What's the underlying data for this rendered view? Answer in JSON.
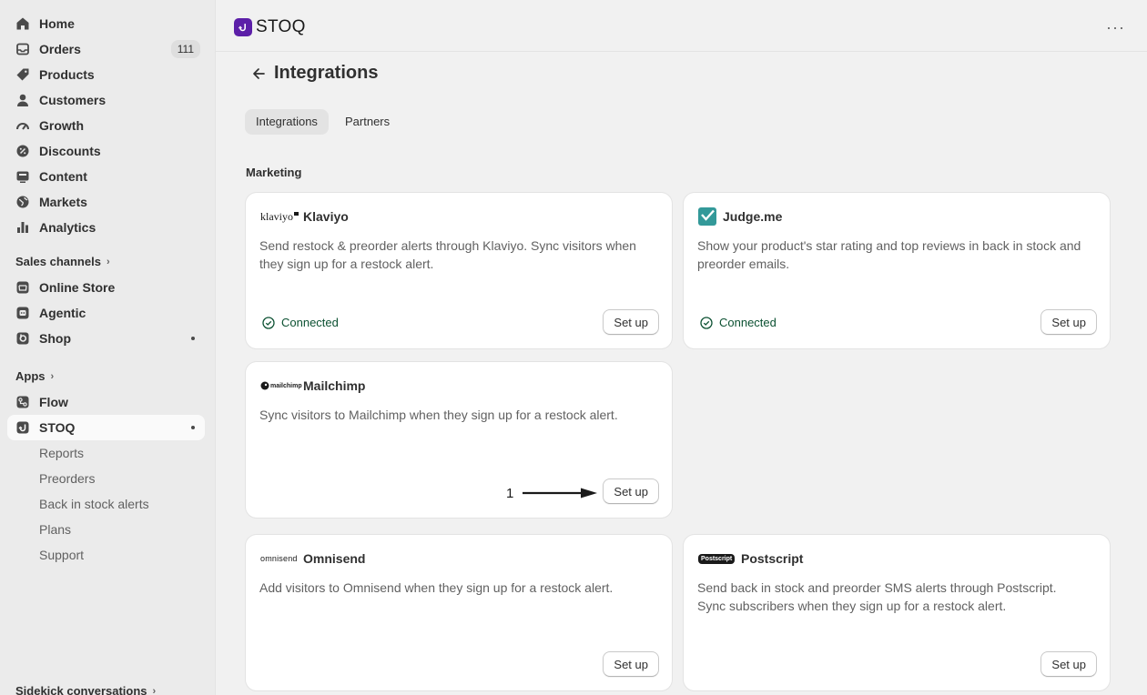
{
  "sidebar": {
    "nav": [
      {
        "label": "Home",
        "icon": "home-icon"
      },
      {
        "label": "Orders",
        "icon": "orders-icon",
        "badge": "111"
      },
      {
        "label": "Products",
        "icon": "tag-icon"
      },
      {
        "label": "Customers",
        "icon": "person-icon"
      },
      {
        "label": "Growth",
        "icon": "gauge-icon"
      },
      {
        "label": "Discounts",
        "icon": "discount-icon"
      },
      {
        "label": "Content",
        "icon": "content-icon"
      },
      {
        "label": "Markets",
        "icon": "globe-icon"
      },
      {
        "label": "Analytics",
        "icon": "bar-chart-icon"
      }
    ],
    "sales_channels": {
      "heading": "Sales channels",
      "items": [
        {
          "label": "Online Store",
          "icon": "store-icon"
        },
        {
          "label": "Agentic",
          "icon": "agent-icon"
        },
        {
          "label": "Shop",
          "icon": "shop-icon"
        }
      ]
    },
    "apps": {
      "heading": "Apps",
      "items": [
        {
          "label": "Flow",
          "icon": "flow-icon"
        },
        {
          "label": "STOQ",
          "icon": "stoq-app-icon"
        }
      ],
      "sub_items": [
        "Reports",
        "Preorders",
        "Back in stock alerts",
        "Plans",
        "Support"
      ]
    },
    "footer": "Sidekick conversations"
  },
  "topbar": {
    "app_name": "STOQ",
    "more": "···"
  },
  "page": {
    "title": "Integrations",
    "tabs": [
      "Integrations",
      "Partners"
    ],
    "section": "Marketing"
  },
  "cards": [
    {
      "name": "Klaviyo",
      "logo_text": "klaviyo",
      "desc": "Send restock & preorder alerts through Klaviyo. Sync visitors when they sign up for a restock alert.",
      "status": "Connected",
      "button": "Set up"
    },
    {
      "name": "Judge.me",
      "desc": "Show your product's star rating and top reviews in back in stock and preorder emails.",
      "status": "Connected",
      "button": "Set up"
    },
    {
      "name": "Mailchimp",
      "logo_text": "mailchimp",
      "desc": "Sync visitors to Mailchimp when they sign up for a restock alert.",
      "button": "Set up"
    },
    {
      "name": "Omnisend",
      "logo_text": "omnisend",
      "desc": "Add visitors to Omnisend when they sign up for a restock alert.",
      "button": "Set up"
    },
    {
      "name": "Postscript",
      "logo_text": "Postscript",
      "desc": "Send back in stock and preorder SMS alerts through Postscript. Sync subscribers when they sign up for a restock alert.",
      "button": "Set up"
    }
  ],
  "annotation": {
    "number": "1"
  },
  "colors": {
    "connected": "#0c5132",
    "stoq_brand": "#5c1fa8",
    "judgeme": "#339999"
  }
}
